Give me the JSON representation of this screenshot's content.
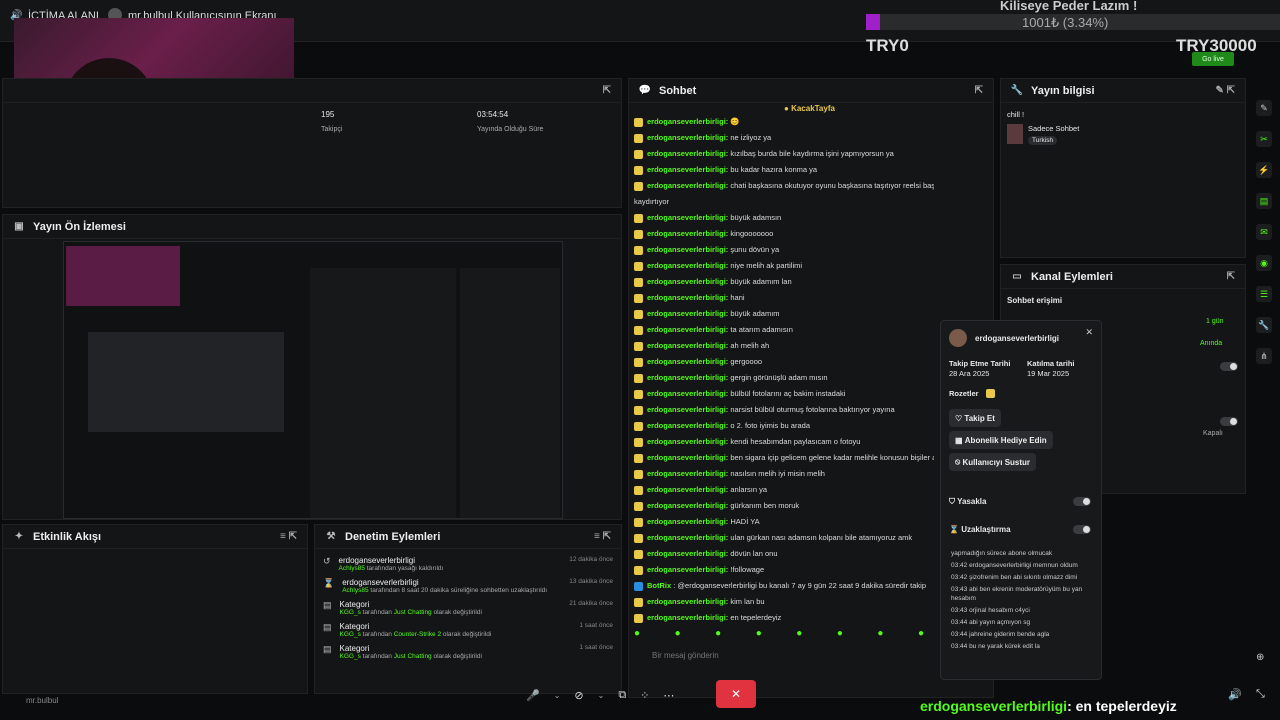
{
  "topbar": {
    "broadcast_label": "İCTİMA ALANI",
    "screen_label": "mr.bulbul Kullanıcısının Ekranı",
    "overlay_title": "Kiliseye Peder Lazım !",
    "goal_text": "1001₺ (3.34%)",
    "goal_left": "TRY0",
    "goal_right": "TRY30000",
    "go_live": "Go live"
  },
  "stats": {
    "followers_value": "195",
    "followers_label": "Takipçi",
    "uptime_value": "03:54:54",
    "uptime_label": "Yayında Olduğu Süre"
  },
  "preview": {
    "title": "Yayın Ön İzlemesi"
  },
  "activity": {
    "title": "Etkinlik Akışı"
  },
  "moderation": {
    "title": "Denetim Eylemleri",
    "items": [
      {
        "title": "erdoganseverlerbirligi",
        "actor": "Achlys85",
        "text": "tarafından yasağı kaldırıldı",
        "time": "12 dakika önce"
      },
      {
        "title": "erdoganseverlerbirligi",
        "actor": "Achlys85",
        "text": "tarafından 8 saat 20 dakika süreliğine sohbetten uzaklaştırıldı",
        "time": "13 dakika önce"
      },
      {
        "title": "Kategori",
        "actor": "KGG_s",
        "text_pre": "tarafından",
        "highlight": "Just Chatting",
        "text_post": "olarak değiştirildi",
        "time": "21 dakika önce"
      },
      {
        "title": "Kategori",
        "actor": "KGG_s",
        "text_pre": "tarafından",
        "highlight": "Counter-Strike 2",
        "text_post": "olarak değiştirildi",
        "time": "1 saat önce"
      },
      {
        "title": "Kategori",
        "actor": "KGG_s",
        "text_pre": "tarafından",
        "highlight": "Just Chatting",
        "text_post": "olarak değiştirildi",
        "time": "1 saat önce"
      }
    ]
  },
  "chat": {
    "title": "Sohbet",
    "pinned_user": "KacakTayfa",
    "user": "erdoganseverlerbirligi",
    "messages": [
      "😊",
      "ne izliyoz ya",
      "kızılbaş burda bile kaydırma işini yapmıyorsun ya",
      "bu kadar hazıra konma ya",
      "chati başkasına okutuyor oyunu başkasına taşıtıyor reelsi başkasına",
      "büyük adamsın",
      "kingooooooo",
      "şunu dövün ya",
      "niye melih ak partilimi",
      "büyük adamım lan",
      "hani",
      "büyük adamım",
      "ta atarım adamısın",
      "ah melih ah",
      "gergoooo",
      "gergin görünüşlü adam mısın",
      "bülbül fotolarını aç bakim instadaki",
      "narsist bülbül oturmuş fotolarına baktırıyor yayına",
      "o 2. foto iyimis bu arada",
      "kendi hesabımdan paylasıcam o fotoyu",
      "ben sigara içip gelicem gelene kadar melihle konusun bişiler a",
      "nasılsın melih iyi misin melih",
      "anlarsın ya",
      "gürkanım ben moruk",
      "HADİ YA",
      "ulan gürkan nası adamsın kolpanı bile atamıyoruz amk",
      "dövün lan onu",
      "!followage"
    ],
    "continuation": "kaydırtıyor",
    "bot_user": "BotRix",
    "bot_text": ": @erdoganseverlerbirligi bu kanalı 7 ay 9 gün 22 saat 9 dakika süredir takip",
    "after_bot": [
      "kim lan bu",
      "en tepelerdeyiz"
    ],
    "input_placeholder": "Bir mesaj gönderin"
  },
  "stream_info": {
    "title": "Yayın bilgisi",
    "stream_title": "chill !",
    "category": "Sadece Sohbet",
    "language": "Turkish"
  },
  "channel_actions": {
    "title": "Kanal Eylemleri",
    "chat_access": "Sohbet erişimi",
    "row1_value": "1 gün",
    "row2_value": "Anında",
    "row5_value": "Kapalı"
  },
  "user_popup": {
    "username": "erdoganseverlerbirligi",
    "follow_label": "Takip Etme Tarihi",
    "follow_date": "28 Ara 2025",
    "join_label": "Katılma tarihi",
    "join_date": "19 Mar 2025",
    "badges_label": "Rozetler",
    "follow_btn": "Takip Et",
    "gift_btn": "Abonelik Hediye Edin",
    "mute_btn": "Kullanıcıyı Sustur",
    "ban_label": "Yasakla",
    "timeout_label": "Uzaklaştırma",
    "history": [
      "yapmadığın sürece abone olmucak",
      "03:42 erdoganseverlerbirligi memnun oldum",
      "03:42 şizofrenim ben abi sıkıntı olmazz dimi",
      "03:43 abi ben ekrenin moderatörüyüm bu yan hesabım",
      "03:43 orjinal hesabım c4yci",
      "03:44 abi yayın açmıyon sg",
      "03:44 jahreine giderim bende agla",
      "03:44 bu ne yarak kürek edit la"
    ]
  },
  "bottom": {
    "overlay_user": "erdoganseverlerbirligi",
    "overlay_text": ": en tepelerdeyiz",
    "watermark": "mr.bulbul"
  },
  "colors": {
    "accent": "#53fc18",
    "end_button": "#e0323f",
    "bg": "#0b0c0d"
  }
}
